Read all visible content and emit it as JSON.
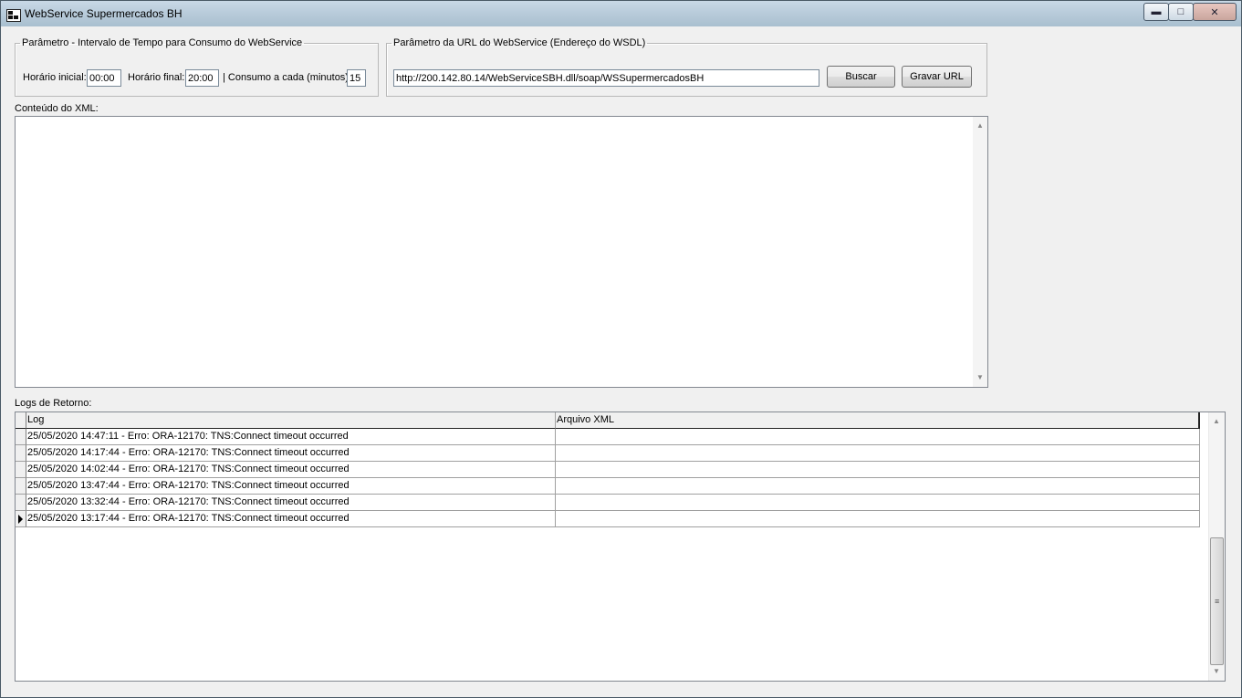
{
  "window": {
    "title": "WebService Supermercados BH",
    "min_glyph": "▬",
    "max_glyph": "□",
    "close_glyph": "✕"
  },
  "time_group": {
    "legend": "Parâmetro - Intervalo de Tempo para Consumo do WebService",
    "start_label": "Horário inicial:",
    "start_value": "00:00",
    "end_label": "Horário final:",
    "end_value": "20:00",
    "interval_label": "| Consumo a cada (minutos):",
    "interval_value": "15"
  },
  "url_group": {
    "legend": "Parâmetro da URL do WebService (Endereço do WSDL)",
    "url_value": "http://200.142.80.14/WebServiceSBH.dll/soap/WSSupermercadosBH",
    "search_label": "Buscar",
    "save_label": "Gravar URL"
  },
  "xml": {
    "label": "Conteúdo do XML:",
    "content": ""
  },
  "logs": {
    "label": "Logs de Retorno:",
    "columns": [
      "Log",
      "Arquivo XML"
    ],
    "rows": [
      {
        "log": "25/05/2020 14:47:11 - Erro: ORA-12170: TNS:Connect timeout occurred",
        "file": ""
      },
      {
        "log": "25/05/2020 14:17:44 - Erro: ORA-12170: TNS:Connect timeout occurred",
        "file": ""
      },
      {
        "log": "25/05/2020 14:02:44 - Erro: ORA-12170: TNS:Connect timeout occurred",
        "file": ""
      },
      {
        "log": "25/05/2020 13:47:44 - Erro: ORA-12170: TNS:Connect timeout occurred",
        "file": ""
      },
      {
        "log": "25/05/2020 13:32:44 - Erro: ORA-12170: TNS:Connect timeout occurred",
        "file": ""
      },
      {
        "log": "25/05/2020 13:17:44 - Erro: ORA-12170: TNS:Connect timeout occurred",
        "file": ""
      }
    ],
    "selected_row": 5
  }
}
